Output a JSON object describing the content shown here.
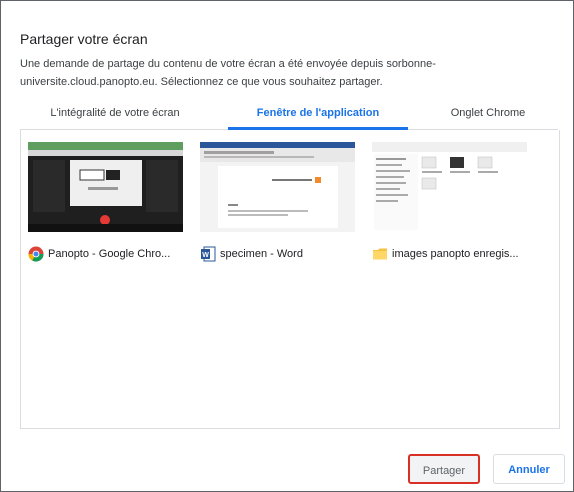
{
  "dialog": {
    "title": "Partager votre écran",
    "description": "Une demande de partage du contenu de votre écran a été envoyée depuis sorbonne-universite.cloud.panopto.eu. Sélectionnez ce que vous souhaitez partager."
  },
  "tabs": [
    {
      "label": "L'intégralité de votre écran",
      "selected": false
    },
    {
      "label": "Fenêtre de l'application",
      "selected": true
    },
    {
      "label": "Onglet Chrome",
      "selected": false
    }
  ],
  "windows": [
    {
      "title": "Panopto - Google Chro...",
      "icon": "chrome-icon"
    },
    {
      "title": "specimen - Word",
      "icon": "word-icon"
    },
    {
      "title": "images panopto enregis...",
      "icon": "folder-icon"
    }
  ],
  "buttons": {
    "share": "Partager",
    "cancel": "Annuler"
  },
  "colors": {
    "accent": "#1a73e8",
    "highlight": "#d93025"
  }
}
